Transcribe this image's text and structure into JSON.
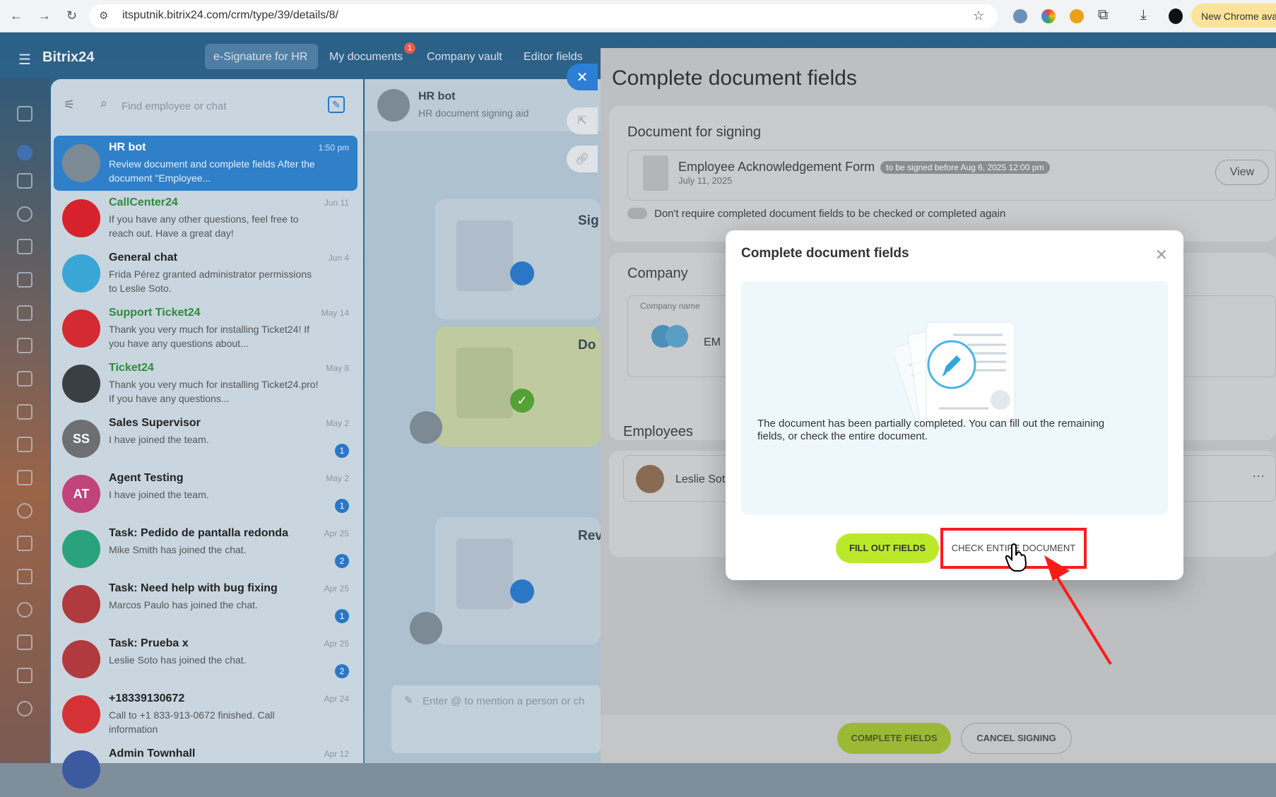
{
  "browser": {
    "url": "itsputnik.bitrix24.com/crm/type/39/details/8/",
    "new_chrome_label": "New Chrome avai"
  },
  "app": {
    "logo": "Bitrix24",
    "tabs": [
      "e-Signature for HR",
      "My documents",
      "Company vault",
      "Editor fields"
    ],
    "my_documents_badge": "1"
  },
  "chat": {
    "search_placeholder": "Find employee or chat",
    "items": [
      {
        "name": "HR bot",
        "message": "Review document and complete fields After the document \"Employee...",
        "date": "1:50 pm",
        "badge": "",
        "avatar_text": "",
        "avatar_color": "#7c8a96"
      },
      {
        "name": "CallCenter24",
        "message": "If you have any other questions, feel free to reach out. Have a great day!",
        "date": "Jun 11",
        "badge": "",
        "avatar_text": "",
        "avatar_color": "#d7222e"
      },
      {
        "name": "General chat",
        "message": "Frida Pérez granted administrator permissions to Leslie Soto.",
        "date": "Jun 4",
        "badge": "",
        "avatar_text": "",
        "avatar_color": "#3aa6d6"
      },
      {
        "name": "Support Ticket24",
        "message": "Thank you very much for installing Ticket24! If you have any questions about...",
        "date": "May 14",
        "badge": "",
        "avatar_text": "",
        "avatar_color": "#d42a32"
      },
      {
        "name": "Ticket24",
        "message": "Thank you very much for installing Ticket24.pro! If you have any questions...",
        "date": "May 8",
        "badge": "",
        "avatar_text": "",
        "avatar_color": "#3a3f44"
      },
      {
        "name": "Sales Supervisor",
        "message": "I have joined the team.",
        "date": "May 2",
        "badge": "1",
        "avatar_text": "SS",
        "avatar_color": "#6d6f71"
      },
      {
        "name": "Agent Testing",
        "message": "I have joined the team.",
        "date": "May 2",
        "badge": "1",
        "avatar_text": "AT",
        "avatar_color": "#c0447a"
      },
      {
        "name": "Task: Pedido de pantalla redonda",
        "message": "Mike Smith has joined the chat.",
        "date": "Apr 25",
        "badge": "2",
        "avatar_text": "",
        "avatar_color": "#2aa27c"
      },
      {
        "name": "Task: Need help with bug fixing",
        "message": "Marcos Paulo has joined the chat.",
        "date": "Apr 25",
        "badge": "1",
        "avatar_text": "",
        "avatar_color": "#b03a3e"
      },
      {
        "name": "Task: Prueba x",
        "message": "Leslie Soto has joined the chat.",
        "date": "Apr 25",
        "badge": "2",
        "avatar_text": "",
        "avatar_color": "#b03a3e"
      },
      {
        "name": "+18339130672",
        "message": "Call to +1 833-913-0672 finished. Call information",
        "date": "Apr 24",
        "badge": "",
        "avatar_text": "",
        "avatar_color": "#d53238"
      },
      {
        "name": "Admin Townhall",
        "message": "",
        "date": "Apr 12",
        "badge": "",
        "avatar_text": "",
        "avatar_color": "#3c5aa0"
      }
    ]
  },
  "conversation": {
    "title": "HR bot",
    "subtitle": "HR document signing aid",
    "input_placeholder": "Enter @ to mention a person or ch",
    "card_titles": [
      "Sig",
      "Do",
      "Rev"
    ]
  },
  "slider": {
    "title": "Complete document fields",
    "doc_section_title": "Document for signing",
    "doc_name": "Employee Acknowledgement Form",
    "doc_deadline": "to be signed before Aug 6, 2025 12:00 pm",
    "doc_date": "July 11, 2025",
    "view_label": "View",
    "toggle_label": "Don't require completed document fields to be checked or completed again",
    "company_title": "Company",
    "company_name_label": "Company name",
    "company_value": "EM",
    "employees_title": "Employees",
    "employee_name": "Leslie Sot",
    "complete_btn": "COMPLETE FIELDS",
    "cancel_btn": "CANCEL SIGNING"
  },
  "modal": {
    "title": "Complete document fields",
    "text": "The document has been partially completed. You can fill out the remaining fields, or check the entire document.",
    "fill_btn": "FILL OUT FIELDS",
    "check_btn": "CHECK ENTIRE DOCUMENT"
  },
  "colors": {
    "accent_green": "#bbe92a",
    "highlight_red": "#ff1a1a",
    "primary_blue": "#2b77c6"
  }
}
